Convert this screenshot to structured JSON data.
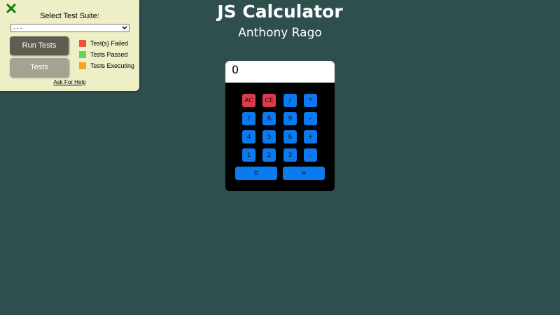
{
  "test_panel": {
    "suite_label": "Select Test Suite:",
    "suite_select_value": "- - -",
    "run_button_label": "Run Tests",
    "tests_button_label": "Tests",
    "legend": [
      {
        "label": "Test(s) Failed",
        "color": "#f0523a"
      },
      {
        "label": "Tests Passed",
        "color": "#5fd45f"
      },
      {
        "label": "Tests Executing",
        "color": "#f5a623"
      }
    ],
    "help_link": "Ask For Help",
    "close_icon": "close-x-icon",
    "close_color": "#0a7a0a"
  },
  "header": {
    "title": "JS Calculator",
    "subtitle": "Anthony Rago"
  },
  "calculator": {
    "display": "0",
    "keys": {
      "ac": "AC",
      "ce": "CE",
      "divide": "/",
      "multiply": "*",
      "seven": "7",
      "eight": "8",
      "nine": "9",
      "subtract": "-",
      "four": "4",
      "five": "5",
      "six": "6",
      "add": "+",
      "one": "1",
      "two": "2",
      "three": "3",
      "decimal": ".",
      "zero": "0",
      "equals": "="
    }
  }
}
